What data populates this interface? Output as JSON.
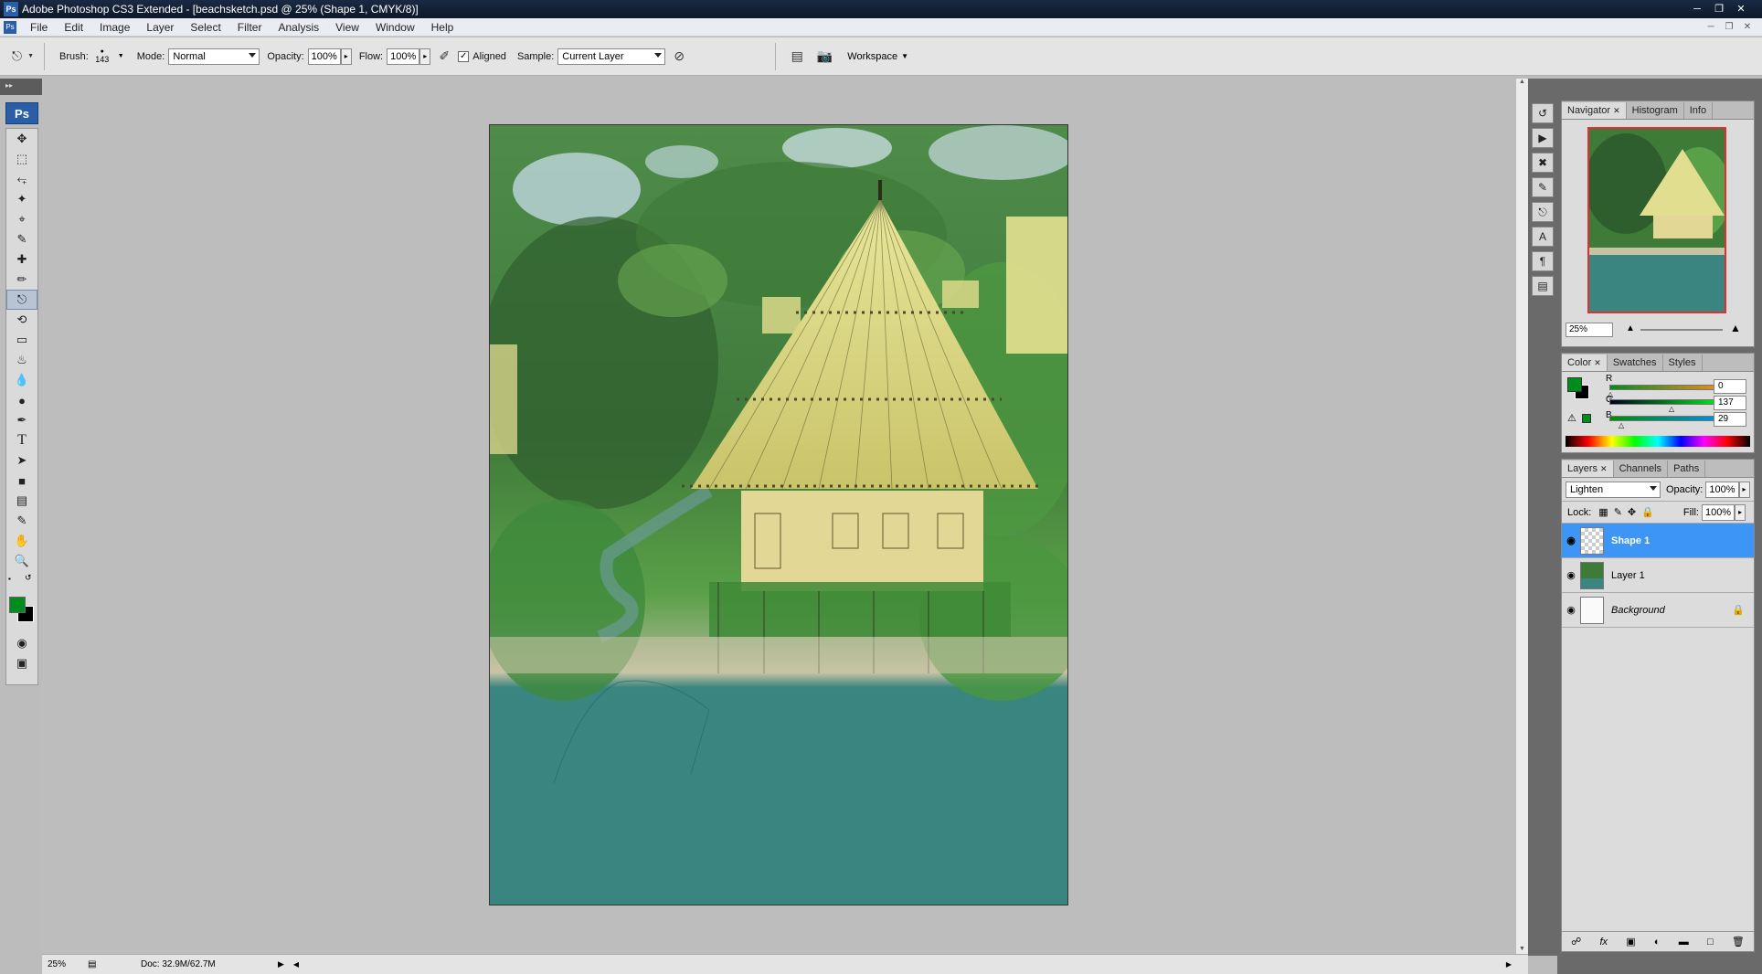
{
  "window": {
    "title": "Adobe Photoshop CS3 Extended - [beachsketch.psd @ 25% (Shape 1, CMYK/8)]",
    "app_icon": "Ps",
    "buttons": [
      "minimize-icon",
      "restore-icon",
      "close-icon"
    ]
  },
  "menubar": {
    "items": [
      "File",
      "Edit",
      "Image",
      "Layer",
      "Select",
      "Filter",
      "Analysis",
      "View",
      "Window",
      "Help"
    ]
  },
  "options": {
    "brush_label": "Brush:",
    "brush_size": "143",
    "mode_label": "Mode:",
    "mode_value": "Normal",
    "opacity_label": "Opacity:",
    "opacity_value": "100%",
    "flow_label": "Flow:",
    "flow_value": "100%",
    "aligned_label": "Aligned",
    "aligned_checked": true,
    "sample_label": "Sample:",
    "sample_value": "Current Layer",
    "workspace_label": "Workspace"
  },
  "tools": [
    "move-tool-icon",
    "marquee-tool-icon",
    "lasso-tool-icon",
    "magic-wand-tool-icon",
    "crop-tool-icon",
    "slice-tool-icon",
    "healing-brush-tool-icon",
    "brush-tool-icon",
    "clone-stamp-tool-icon",
    "history-brush-tool-icon",
    "eraser-tool-icon",
    "paint-bucket-tool-icon",
    "blur-tool-icon",
    "dodge-tool-icon",
    "pen-tool-icon",
    "type-tool-icon",
    "path-selection-tool-icon",
    "shape-tool-icon",
    "notes-tool-icon",
    "eyedropper-tool-icon",
    "hand-tool-icon",
    "zoom-tool-icon"
  ],
  "selected_tool": "clone-stamp-tool-icon",
  "colors": {
    "foreground": "#008d1d",
    "background": "#000000",
    "selection_blue": "#3d95f5"
  },
  "status": {
    "zoom": "25%",
    "doc": "Doc: 32.9M/62.7M"
  },
  "navigator": {
    "tabs": [
      "Navigator",
      "Histogram",
      "Info"
    ],
    "zoom": "25%"
  },
  "color_panel": {
    "tabs": [
      "Color",
      "Swatches",
      "Styles"
    ],
    "channels": [
      {
        "label": "R",
        "value": "0"
      },
      {
        "label": "G",
        "value": "137"
      },
      {
        "label": "B",
        "value": "29"
      }
    ]
  },
  "layers_panel": {
    "tabs": [
      "Layers",
      "Channels",
      "Paths"
    ],
    "blend_mode": "Lighten",
    "opacity_label": "Opacity:",
    "opacity_value": "100%",
    "lock_label": "Lock:",
    "fill_label": "Fill:",
    "fill_value": "100%",
    "layers": [
      {
        "name": "Shape 1",
        "selected": true
      },
      {
        "name": "Layer 1",
        "selected": false
      },
      {
        "name": "Background",
        "selected": false,
        "locked": true
      }
    ]
  }
}
